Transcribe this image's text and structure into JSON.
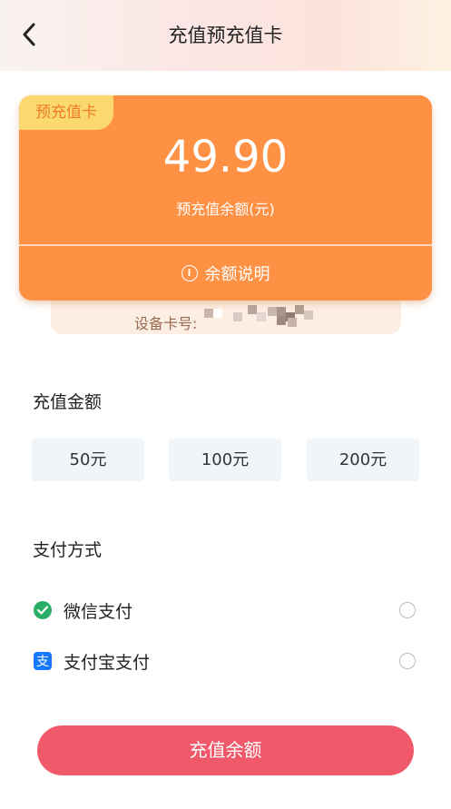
{
  "header": {
    "title": "充值预充值卡",
    "back_icon": "chevron-left-icon"
  },
  "card": {
    "tag": "预充值卡",
    "balance": "49.90",
    "balance_label": "预充值余额(元)",
    "explain_label": "余额说明",
    "device_label": "设备卡号"
  },
  "recharge": {
    "title": "充值金额",
    "amounts": [
      "50元",
      "100元",
      "200元"
    ]
  },
  "payment": {
    "title": "支付方式",
    "methods": [
      {
        "label": "微信支付",
        "icon": "wechat-pay-icon",
        "color": "#2aae67"
      },
      {
        "label": "支付宝支付",
        "icon": "alipay-icon",
        "color": "#1677ff"
      }
    ]
  },
  "submit": {
    "label": "充值余额"
  },
  "colors": {
    "card": "#ff9145",
    "tag_bg": "#fcd96f",
    "submit": "#f0596a"
  }
}
